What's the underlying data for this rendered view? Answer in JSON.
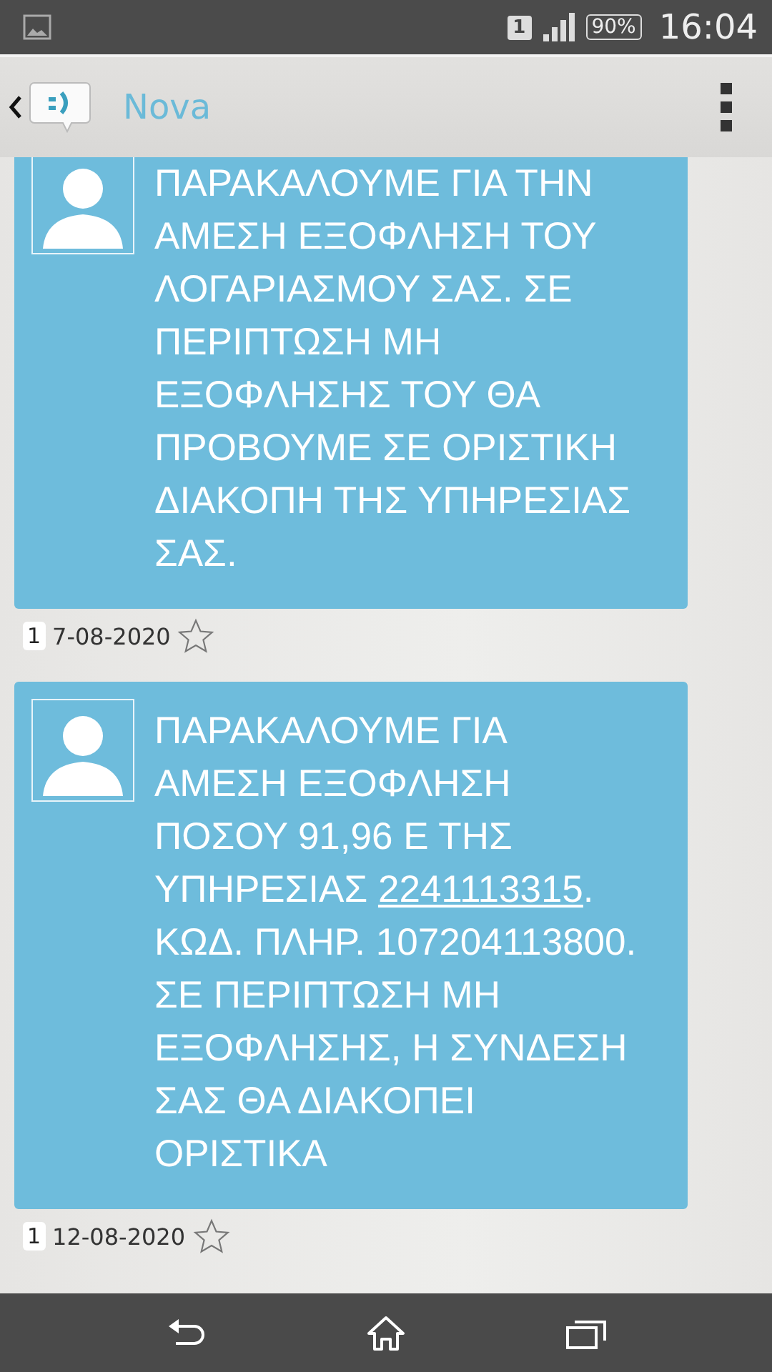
{
  "status_bar": {
    "sim": "1",
    "battery": "90%",
    "time": "16:04"
  },
  "app_bar": {
    "title": "Nova"
  },
  "messages": [
    {
      "segments": [
        {
          "kind": "plain",
          "text": "ΠΑΡΑΚΑΛΟΥΜΕ ΓΙΑ ΤΗΝ ΑΜΕΣΗ ΕΞΟΦΛΗΣΗ ΤΟΥ ΛΟΓΑΡΙΑΣΜΟΥ ΣΑΣ. ΣΕ ΠΕΡΙΠΤΩΣΗ ΜΗ ΕΞΟΦΛΗΣΗΣ ΤΟΥ ΘΑ ΠΡΟΒΟΥΜΕ ΣΕ ΟΡΙΣΤΙΚΗ ΔΙΑΚΟΠΗ ΤΗΣ ΥΠΗΡΕΣΙΑΣ ΣΑΣ."
        }
      ],
      "sim": "1",
      "date": "7-08-2020",
      "starred": false
    },
    {
      "segments": [
        {
          "kind": "plain",
          "text": "ΠΑΡΑΚΑΛΟΥΜΕ ΓΙΑ ΑΜΕΣΗ ΕΞΟΦΛΗΣΗ ΠΟΣΟΥ 91,96 Ε ΤΗΣ ΥΠΗΡΕΣΙΑΣ "
        },
        {
          "kind": "link",
          "text": "2241113315"
        },
        {
          "kind": "plain",
          "text": ". ΚΩΔ. ΠΛΗΡ. 107204113800. ΣΕ ΠΕΡΙΠΤΩΣΗ ΜΗ ΕΞΟΦΛΗΣΗΣ, Η ΣΥΝΔΕΣΗ ΣΑΣ ΘΑ ΔΙΑΚΟΠΕΙ ΟΡΙΣΤΙΚΑ"
        }
      ],
      "sim": "1",
      "date": "12-08-2020",
      "starred": false
    }
  ]
}
